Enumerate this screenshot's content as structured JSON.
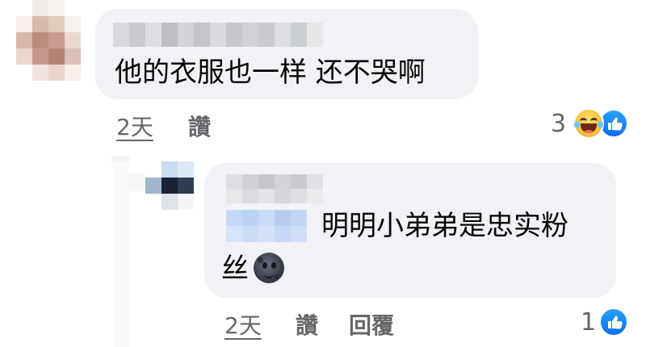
{
  "comments": [
    {
      "text": "他的衣服也一样 还不哭啊",
      "time": "2天",
      "like_label": "讚",
      "reaction_count": "3",
      "reactions": [
        "laugh-icon",
        "like-icon"
      ]
    }
  ],
  "reply": {
    "text_line1": "明明小弟弟是忠实粉",
    "text_line2": "丝",
    "time": "2天",
    "like_label": "讚",
    "reply_label": "回覆",
    "reaction_count": "1",
    "emoji": "new-moon-face-icon",
    "reactions": [
      "like-icon"
    ]
  },
  "colors": {
    "bubble": "#f0f2f5",
    "meta_text": "#65676b",
    "like_blue": "#1877f2"
  }
}
